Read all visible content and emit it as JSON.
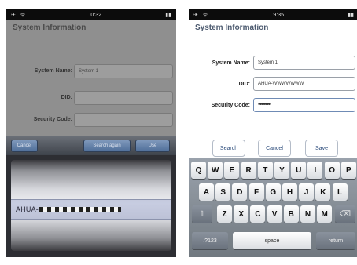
{
  "left_screen": {
    "status": {
      "time": "0:32",
      "left_icons": "✈ ᯤ",
      "battery": "▮▮"
    },
    "title": "System Information",
    "fields": [
      {
        "label": "System Name:",
        "value": "System 1"
      },
      {
        "label": "DID:",
        "value": ""
      },
      {
        "label": "Security Code:",
        "value": ""
      }
    ],
    "toolbar": {
      "cancel": "Cancel",
      "search_again": "Search again",
      "done": "Use"
    },
    "picker": {
      "selected_prefix": "AHUA-"
    }
  },
  "right_screen": {
    "status": {
      "time": "9:35",
      "left_icons": "✈ ᯤ",
      "battery": "▮▮"
    },
    "title": "System Information",
    "fields": [
      {
        "label": "System Name:",
        "value": "System 1"
      },
      {
        "label": "DID:",
        "value": "AHUA-WWWWWWW"
      },
      {
        "label": "Security Code:",
        "value": "•••••••"
      }
    ],
    "buttons": {
      "search": "Search",
      "cancel": "Cancel",
      "save": "Save"
    },
    "keyboard": {
      "row1": [
        "Q",
        "W",
        "E",
        "R",
        "T",
        "Y",
        "U",
        "I",
        "O",
        "P"
      ],
      "row2": [
        "A",
        "S",
        "D",
        "F",
        "G",
        "H",
        "J",
        "K",
        "L"
      ],
      "row3": [
        "Z",
        "X",
        "C",
        "V",
        "B",
        "N",
        "M"
      ],
      "shift": "⇧",
      "backspace": "⌫",
      "numbers": ".?123",
      "space": "space",
      "return": "return"
    }
  }
}
